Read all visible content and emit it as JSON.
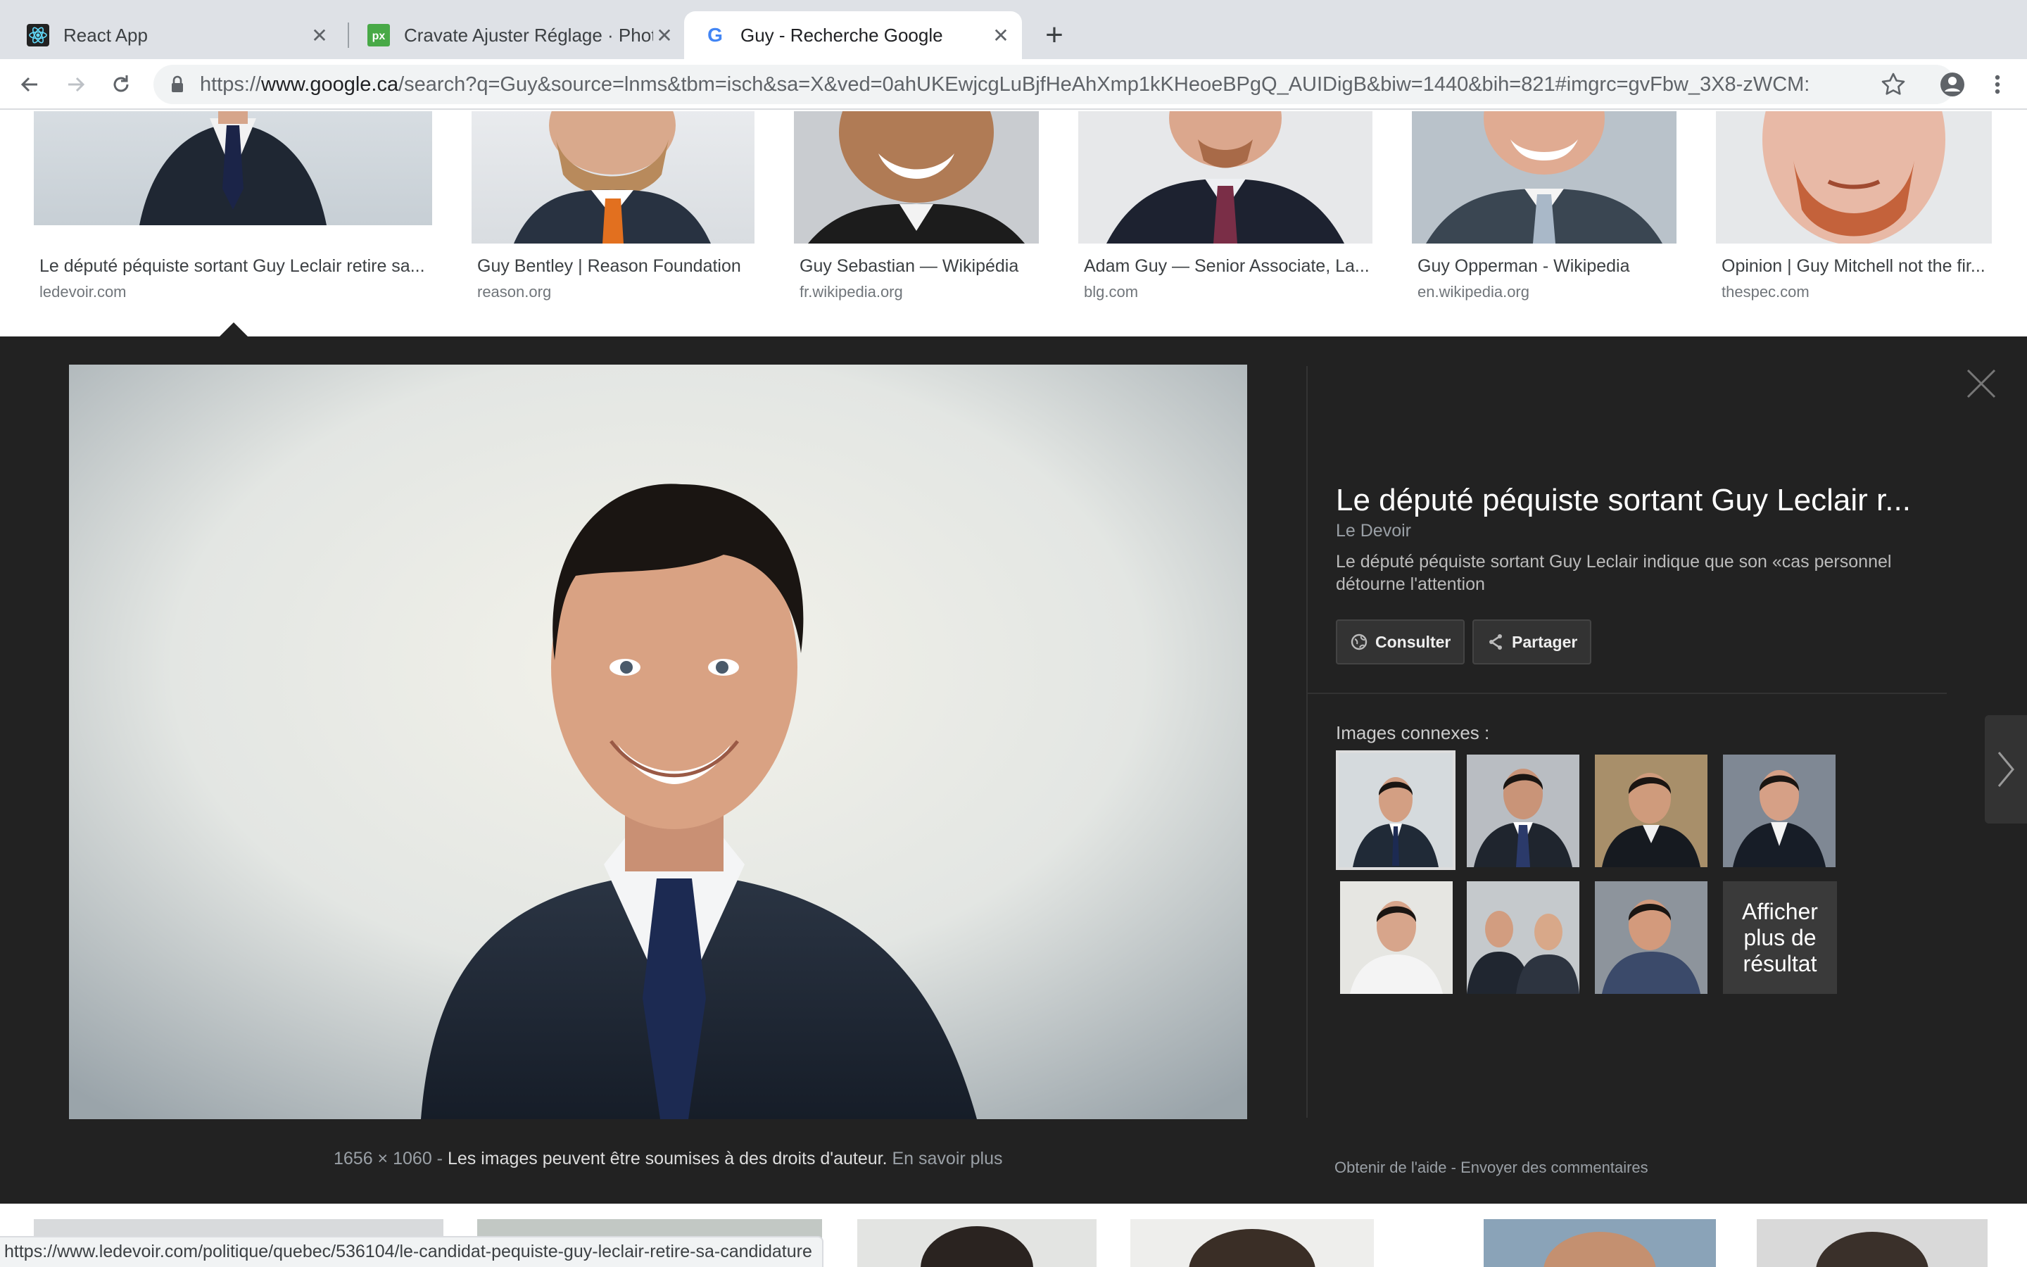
{
  "browser": {
    "tabs": [
      {
        "title": "React App",
        "icon": "react-icon",
        "active": false
      },
      {
        "title": "Cravate Ajuster Réglage · Phot",
        "icon": "pixabay-icon",
        "active": false
      },
      {
        "title": "Guy - Recherche Google",
        "icon": "google-icon",
        "active": true
      }
    ],
    "url_scheme": "https://",
    "url_host": "www.google.ca",
    "url_rest": "/search?q=Guy&source=lnms&tbm=isch&sa=X&ved=0ahUKEwjcgLuBjfHeAhXmp1kKHeoeBPgQ_AUIDigB&biw=1440&bih=821#imgrc=gvFbw_3X8-zWCM:"
  },
  "results_top": [
    {
      "title": "Le député péquiste sortant Guy Leclair retire sa...",
      "source": "ledevoir.com"
    },
    {
      "title": "Guy Bentley | Reason Foundation",
      "source": "reason.org"
    },
    {
      "title": "Guy Sebastian — Wikipédia",
      "source": "fr.wikipedia.org"
    },
    {
      "title": "Adam Guy — Senior Associate, La...",
      "source": "blg.com"
    },
    {
      "title": "Guy Opperman - Wikipedia",
      "source": "en.wikipedia.org"
    },
    {
      "title": "Opinion | Guy Mitchell not the fir...",
      "source": "thespec.com"
    }
  ],
  "preview": {
    "title": "Le député péquiste sortant Guy Leclair r...",
    "source": "Le Devoir",
    "description": "Le député péquiste sortant Guy Leclair indique que son «cas personnel détourne l'attention",
    "visit_label": "Consulter",
    "share_label": "Partager",
    "related_label": "Images connexes :",
    "more_results": "Afficher plus de résultat",
    "dimensions": "1656 × 1060",
    "sep": " - ",
    "copyright_notice": "Les images peuvent être soumises à des droits d'auteur.",
    "learn_more": "En savoir plus",
    "help_link": "Obtenir de l'aide",
    "feedback_link": "Envoyer des commentaires"
  },
  "status_url": "https://www.ledevoir.com/politique/quebec/536104/le-candidat-pequiste-guy-leclair-retire-sa-candidature",
  "colors": {
    "panel_bg": "#222222",
    "tab_strip": "#dee1e6",
    "omnibox": "#f1f3f4"
  }
}
